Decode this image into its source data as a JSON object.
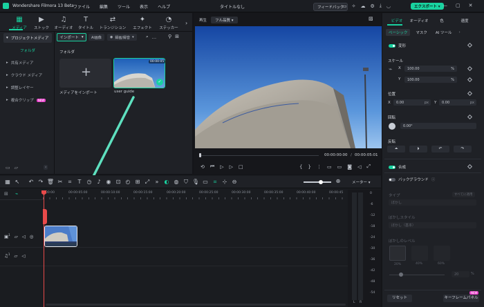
{
  "app": {
    "name": "Wondershare Filmora 13 Beta",
    "menu": [
      "ファイル",
      "編集",
      "ツール",
      "表示",
      "ヘルプ"
    ],
    "document_title": "タイトルなし",
    "feedback_label": "フィードバック",
    "export_label": "エクスポート"
  },
  "media_tabs": [
    {
      "label": "メディア",
      "glyph": "▦"
    },
    {
      "label": "ストック",
      "glyph": "▶"
    },
    {
      "label": "オーディオ",
      "glyph": "♫"
    },
    {
      "label": "タイトル",
      "glyph": "T"
    },
    {
      "label": "トランジション",
      "glyph": "⇄"
    },
    {
      "label": "エフェクト",
      "glyph": "✦"
    },
    {
      "label": "ステッカー",
      "glyph": "◔"
    }
  ],
  "sidebar": {
    "project_media": "プロジェクトメディア",
    "folder": "フォルダ",
    "items": [
      "共有メディア",
      "クラウド メディア",
      "調整レイヤー",
      "複合クリップ"
    ],
    "new_badge": "NEW"
  },
  "media_toolbar": {
    "import_label": "インポート",
    "ai_image": "AI画像",
    "record": "録画/録音"
  },
  "media_area": {
    "folder_label": "フォルダ",
    "import_tile_label": "メディアをインポート",
    "clip_label": "user guide",
    "clip_duration": "00:00:05"
  },
  "player": {
    "label_play": "再生",
    "quality": "フル品質",
    "current_time": "00:00:00:00",
    "total_time": "00:00:05:01",
    "separator": "/"
  },
  "inspector": {
    "tabs": [
      "ビデオ",
      "オーディオ",
      "色",
      "速度"
    ],
    "subtabs": [
      "ベーシック",
      "マスク",
      "AI ツール"
    ],
    "transform": "変形",
    "scale": "スケール",
    "scale_x": "100.00",
    "scale_y": "100.00",
    "percent": "%",
    "position": "位置",
    "pos_x": "0.00",
    "pos_y": "0.00",
    "px": "px",
    "rotate": "回転",
    "rotate_value": "0.00°",
    "flip": "反転",
    "composite": "合成",
    "background": "バックグラウンド",
    "type_label": "タイプ",
    "apply_all": "すべてに適用",
    "blur_value": "ぼかし",
    "blur_style": "ぼかしスタイル",
    "blur_style_value": "ぼかし（基本）",
    "blur_level": "ぼかしのレベル",
    "level_options": [
      "20%",
      "40%",
      "60%"
    ],
    "level_value": "20",
    "reset": "リセット",
    "keyframe_panel": "キーフレームパネル",
    "keyframe_badge": "NEW",
    "axis_x": "X",
    "axis_y": "Y"
  },
  "timeline": {
    "meter_label": "メーター",
    "ruler_ticks": [
      "00:00",
      "00:00:05:00",
      "00:00:10:00",
      "00:00:15:00",
      "00:00:20:00",
      "00:00:25:00",
      "00:00:30:00",
      "00:00:35:00",
      "00:00:40:00",
      "00:00:45"
    ],
    "meter_db": [
      "0",
      "-6",
      "-12",
      "-18",
      "-24",
      "-30",
      "-36",
      "-42",
      "-48",
      "-54"
    ],
    "meter_lr": [
      "L",
      "R"
    ],
    "track_video_num": "1",
    "track_audio_num": "1"
  },
  "colors": {
    "accent": "#19d2a0",
    "playhead": "#e84a4a",
    "new_badge": "#e63cc8"
  }
}
